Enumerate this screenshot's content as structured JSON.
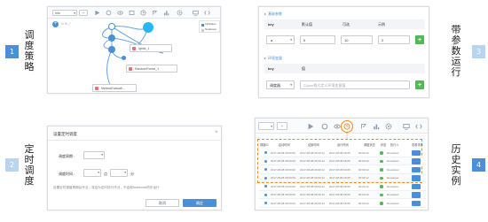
{
  "features": [
    {
      "number": "1",
      "title": "调度策略"
    },
    {
      "number": "2",
      "title": "定时调度"
    },
    {
      "number": "3",
      "title": "带参数运行"
    },
    {
      "number": "4",
      "title": "历史实例"
    }
  ],
  "panel1": {
    "select_value": "Info",
    "nodes": [
      {
        "label": "Ignite_1"
      },
      {
        "label": "RandomForest_1"
      },
      {
        "label": "MetricsEvaluati..."
      }
    ],
    "legend": [
      {
        "label": "Ini/Status"
      },
      {
        "label": "Notebook"
      }
    ]
  },
  "panel2": {
    "section1_title": "基础参数",
    "section1_headers": [
      "key",
      "默认值",
      "可选",
      "示例"
    ],
    "section1_row": {
      "key": "a",
      "default": "0",
      "optional": "10",
      "example": "2"
    },
    "section2_title": "环境变量",
    "section2_headers": [
      "key",
      "值"
    ],
    "section2_row": {
      "key": "调度器",
      "value": "以json格式定义环境变量值"
    },
    "add_symbol": "+"
  },
  "panel3": {
    "dialog_title": "设置定时调度",
    "close_symbol": "×",
    "row1_label": "调度周期 :",
    "row2_label": "调度时间 :",
    "row2_sep1": "点",
    "row2_sep2": "分",
    "note": "设置定时调度周期后作业，将会为定时执行作业，不会和Notebook同步运行",
    "cancel_label": "取消",
    "confirm_label": "确定"
  },
  "panel4": {
    "headers": [
      "调度ID",
      "启动时间",
      "结束时间",
      "运行时间",
      "调度状态",
      "状态",
      "执行人",
      "查看详情"
    ],
    "rows": [
      {
        "id": "1",
        "start": "2017-08-08 09:00:00",
        "end": "2017-08-08 09:00:12",
        "duration": "2017-08-08 09:05",
        "sched": "00:00:12",
        "status": "Running",
        "user": "Developer"
      },
      {
        "id": "2",
        "start": "2017-08-08 09:00:00",
        "end": "2017-08-08 09:00:12",
        "duration": "2017-08-08 09:05",
        "sched": "00:00:12",
        "status": "Running",
        "user": "Developer"
      },
      {
        "id": "3",
        "start": "2017-08-08 09:00:00",
        "end": "2017-08-08 09:00:12",
        "duration": "2017-08-08 09:05",
        "sched": "00:00:12",
        "status": "Running",
        "user": "Developer"
      },
      {
        "id": "4",
        "start": "2017-08-08 09:00:00",
        "end": "2017-08-08 09:00:12",
        "duration": "2017-08-08 09:05",
        "sched": "00:00:12",
        "status": "Running",
        "user": "Developer"
      },
      {
        "id": "5",
        "start": "2017-08-08 09:00:00",
        "end": "2017-08-08 09:00:12",
        "duration": "2017-08-08 09:05",
        "sched": "00:00:12",
        "status": "Running",
        "user": "Developer"
      },
      {
        "id": "6",
        "start": "2017-08-08 09:00:00",
        "end": "2017-08-08 09:00:12",
        "duration": "2017-08-08 09:05",
        "sched": "00:00:12",
        "status": "Running",
        "user": "Developer"
      },
      {
        "id": "7",
        "start": "2017-08-08 09:00:00",
        "end": "2017-08-08 09:00:12",
        "duration": "2017-08-08 09:05",
        "sched": "00:00:12",
        "status": "Running",
        "user": "Developer"
      }
    ]
  },
  "colors": {
    "accent": "#4a90d9",
    "accent_light": "#b8d4ee",
    "green": "#52b755",
    "highlight": "#f08a24"
  },
  "icons": [
    "play-icon",
    "refresh-icon",
    "eye-icon",
    "history-icon",
    "clock-icon",
    "share-icon",
    "chart-icon",
    "settings-icon",
    "monitor-icon",
    "code-icon"
  ]
}
